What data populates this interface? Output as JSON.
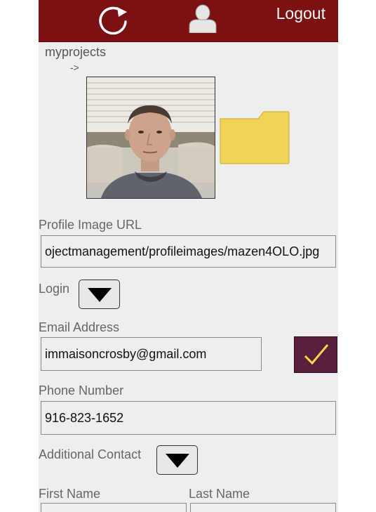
{
  "header": {
    "logout_label": "Logout",
    "refresh_icon": "refresh-icon",
    "user_icon": "user-icon",
    "background": "#7b1113"
  },
  "breadcrumb": {
    "text": "myprojects",
    "arrow": "->"
  },
  "profile": {
    "photo": "profile-photo",
    "folder_icon": "folder-icon"
  },
  "form": {
    "profile_image_url": {
      "label": "Profile Image URL",
      "value": "ojectmanagement/profileimages/mazen4OLO.jpg"
    },
    "login": {
      "label": "Login"
    },
    "email": {
      "label": "Email Address",
      "value": "immaisoncrosby@gmail.com"
    },
    "phone": {
      "label": "Phone Number",
      "value": "916-823-1652"
    },
    "additional_contact": {
      "label": "Additional Contact"
    },
    "first_name": {
      "label": "First Name"
    },
    "last_name": {
      "label": "Last Name"
    }
  },
  "colors": {
    "confirm_button": "#5a1f3a",
    "checkmark": "#f2d84a",
    "folder": "#f0d455"
  }
}
